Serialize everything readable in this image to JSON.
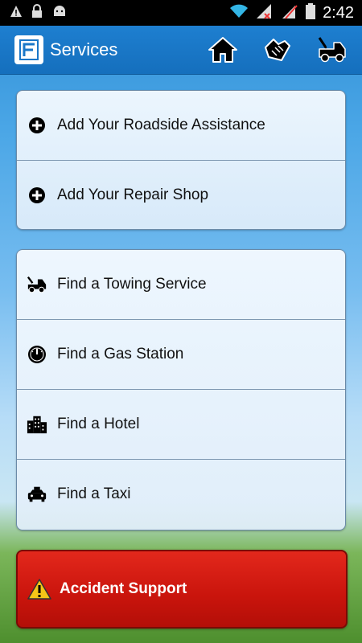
{
  "status_bar": {
    "time": "2:42"
  },
  "app_bar": {
    "title": "Services",
    "actions": [
      {
        "name": "home",
        "icon": "home-icon"
      },
      {
        "name": "call",
        "icon": "phone-handshake-icon"
      },
      {
        "name": "tow",
        "icon": "tow-truck-icon"
      }
    ]
  },
  "groups": [
    {
      "items": [
        {
          "label": "Add Your Roadside Assistance",
          "icon": "plus-circle-icon"
        },
        {
          "label": "Add Your Repair Shop",
          "icon": "plus-circle-icon"
        }
      ]
    },
    {
      "items": [
        {
          "label": "Find a Towing Service",
          "icon": "tow-truck-icon"
        },
        {
          "label": "Find a Gas Station",
          "icon": "gauge-icon"
        },
        {
          "label": "Find a Hotel",
          "icon": "hotel-icon"
        },
        {
          "label": "Find a Taxi",
          "icon": "taxi-icon"
        }
      ]
    }
  ],
  "accident_support": {
    "label": "Accident Support",
    "icon": "warning-icon"
  },
  "colors": {
    "app_bar": "#1a77c8",
    "accident": "#d41e14"
  }
}
